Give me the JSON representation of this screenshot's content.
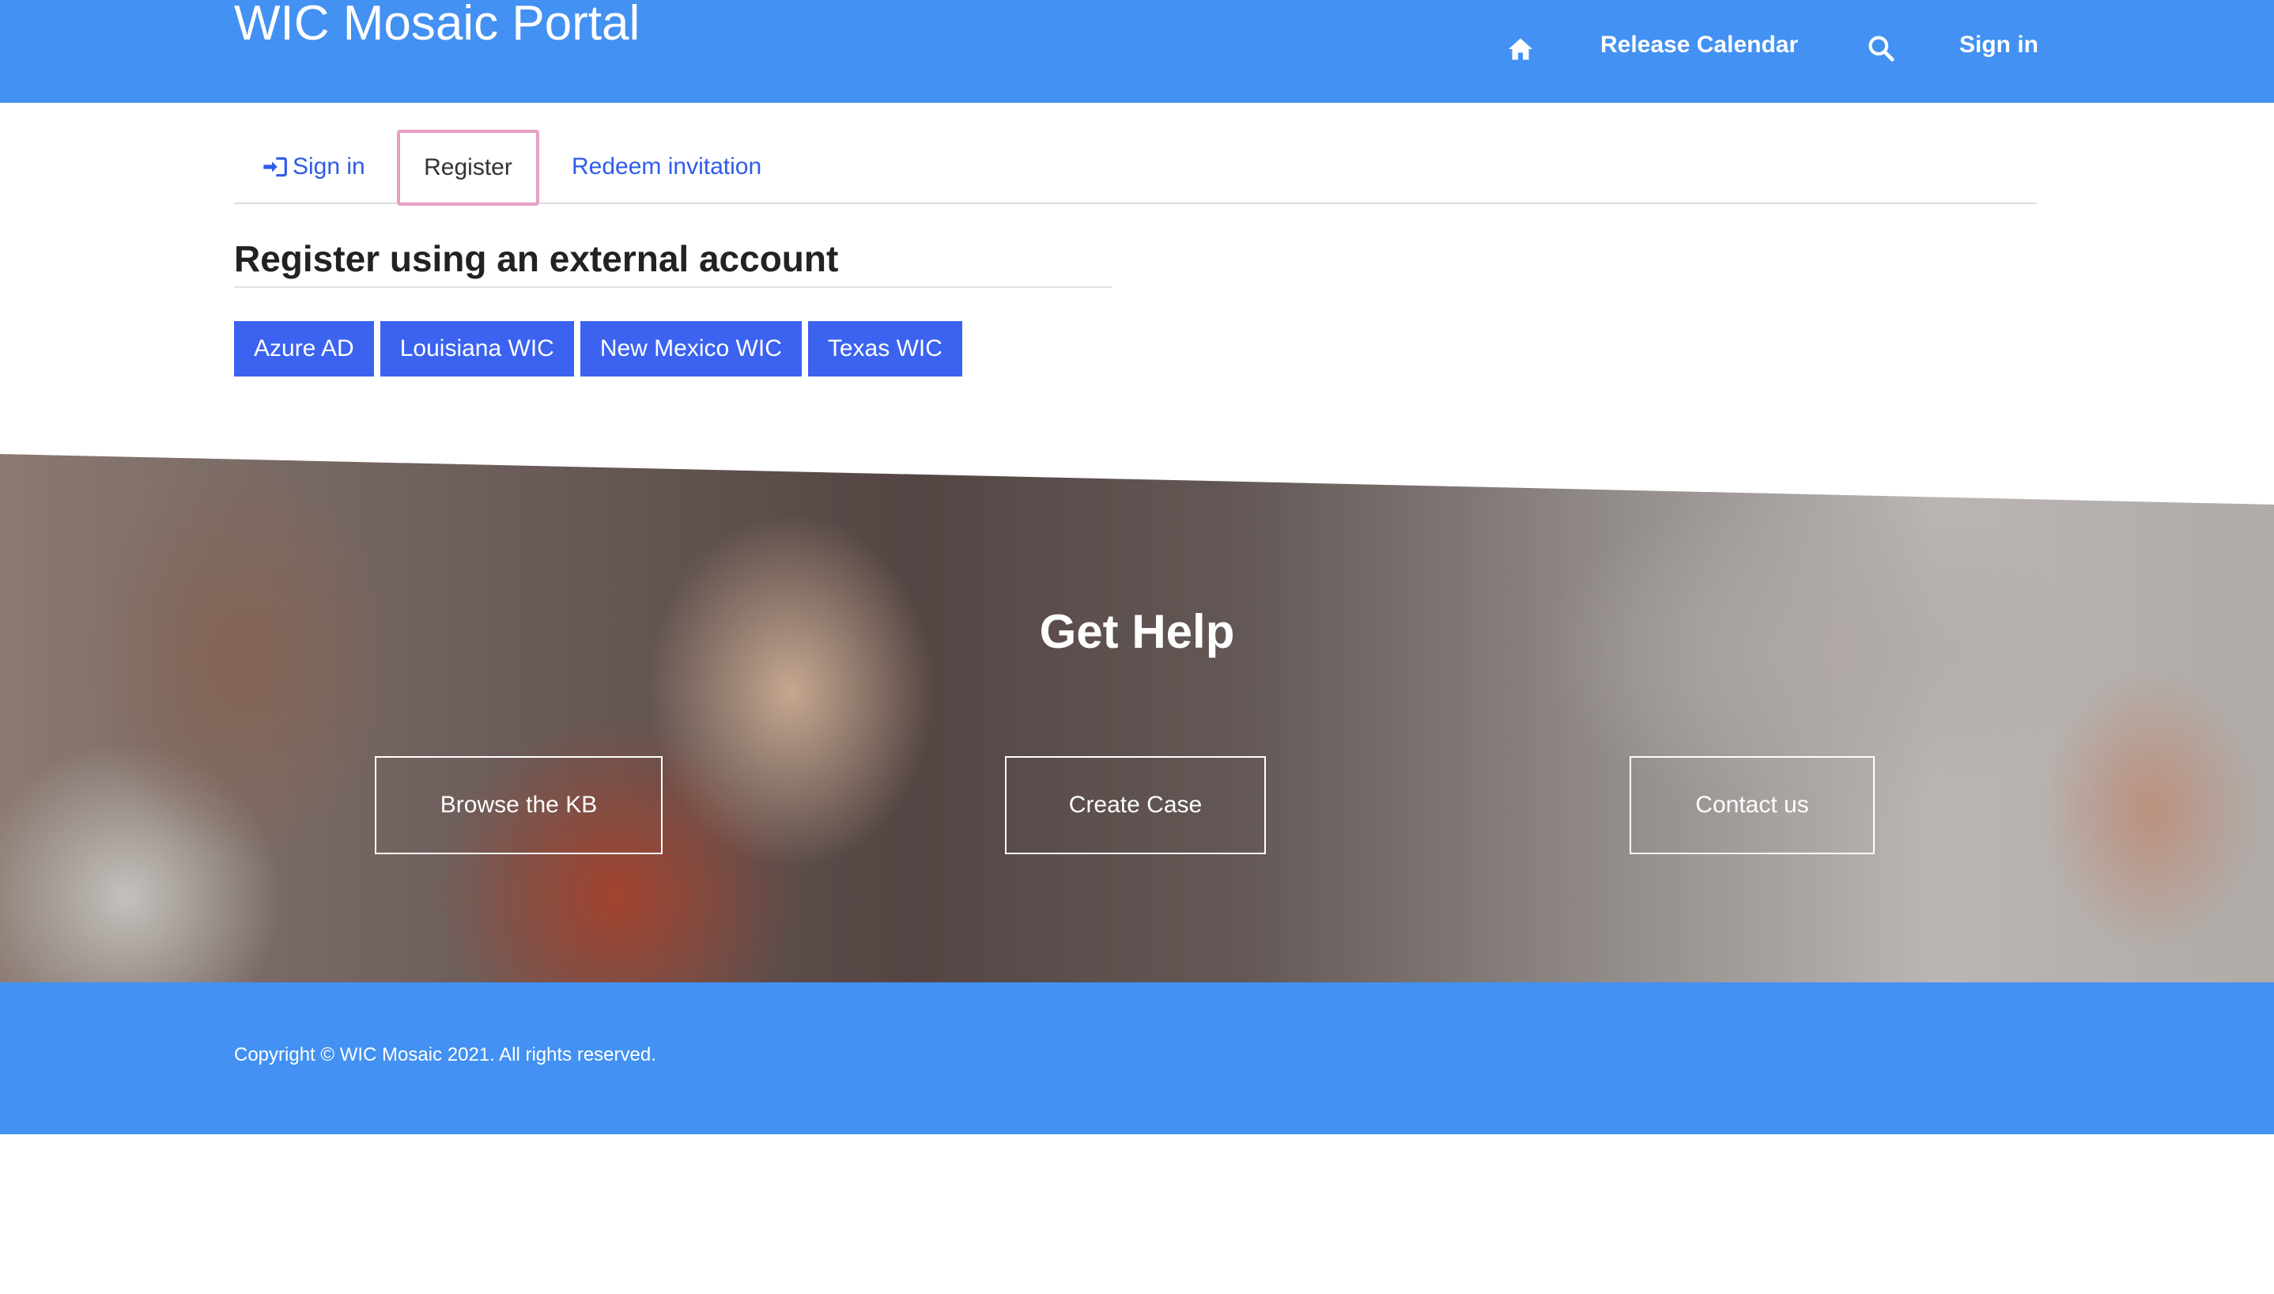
{
  "header": {
    "brand": "WIC Mosaic Portal",
    "nav": {
      "home_icon": "home-icon",
      "release_calendar": "Release Calendar",
      "search_icon": "search-icon",
      "sign_in": "Sign in"
    }
  },
  "tabs": {
    "sign_in": "Sign in",
    "register": "Register",
    "redeem": "Redeem invitation",
    "active": "Register"
  },
  "register": {
    "title": "Register using an external account",
    "providers": [
      "Azure AD",
      "Louisiana WIC",
      "New Mexico WIC",
      "Texas WIC"
    ]
  },
  "hero": {
    "title": "Get Help",
    "buttons": {
      "browse_kb": "Browse the KB",
      "create_case": "Create Case",
      "contact_us": "Contact us"
    }
  },
  "footer": {
    "copyright": "Copyright © WIC Mosaic 2021. All rights reserved."
  },
  "colors": {
    "header_bg": "#4391f2",
    "provider_button": "#3b63f0",
    "tab_link": "#2f5ce8",
    "active_tab_border": "#e79fc6"
  }
}
